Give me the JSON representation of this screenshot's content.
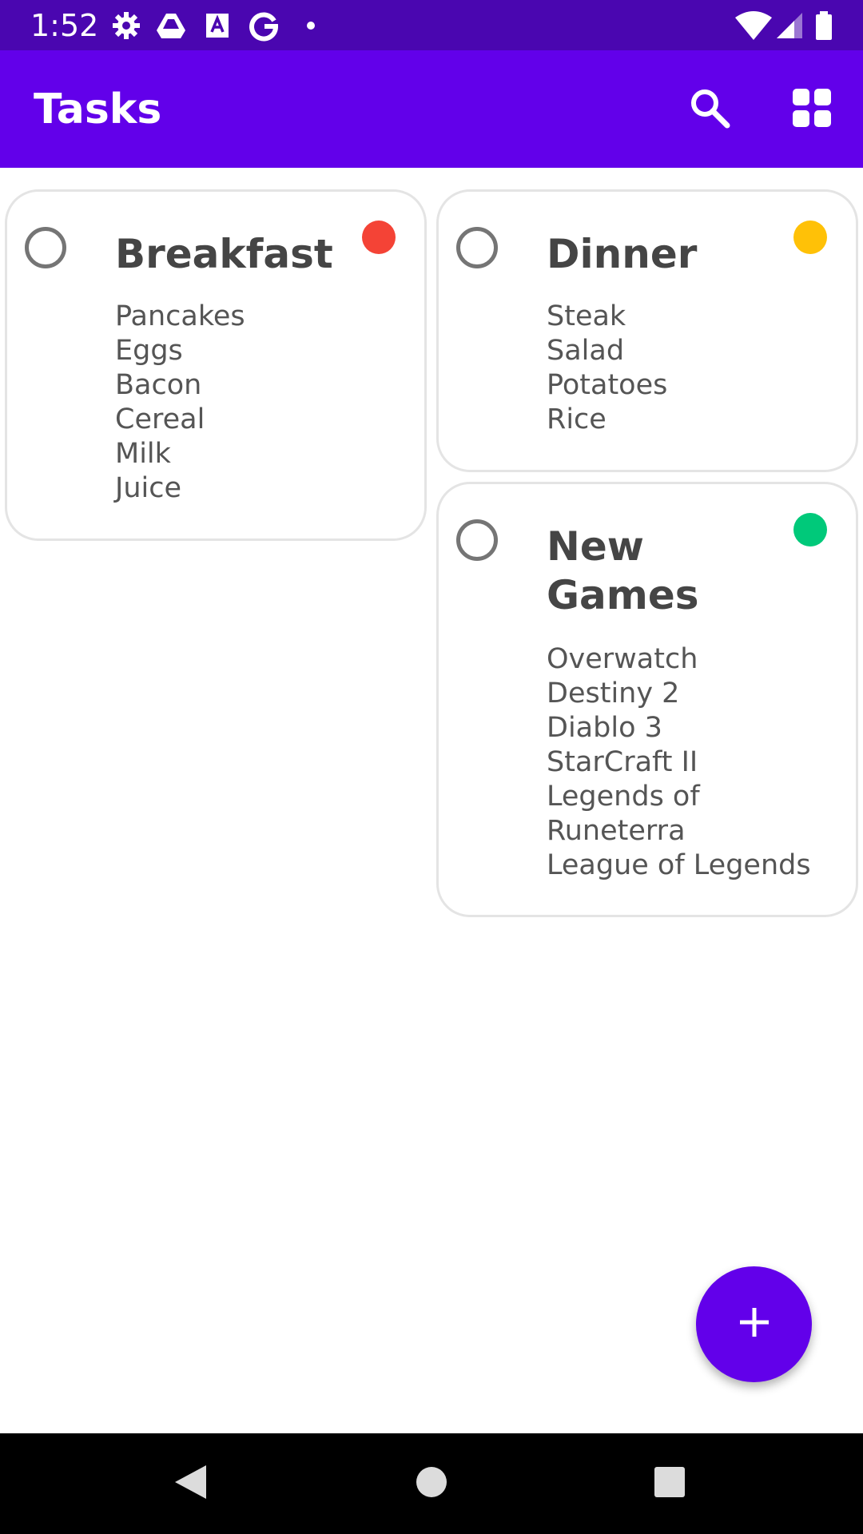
{
  "status_bar": {
    "time": "1:52",
    "left_icons": [
      "settings-icon",
      "drive-icon",
      "text-app-icon",
      "google-icon",
      "dot-icon"
    ],
    "right_icons": [
      "wifi-icon",
      "signal-icon",
      "battery-icon"
    ]
  },
  "app_bar": {
    "title": "Tasks",
    "actions": [
      "search-icon",
      "grid-view-icon"
    ]
  },
  "cards": [
    {
      "title": "Breakfast",
      "color": "#f44336",
      "items": [
        "Pancakes",
        "Eggs",
        "Bacon",
        "Cereal",
        "Milk",
        "Juice"
      ],
      "checked": false
    },
    {
      "title": "Dinner",
      "color": "#ffc107",
      "items": [
        "Steak",
        "Salad",
        "Potatoes",
        "Rice"
      ],
      "checked": false
    },
    {
      "title": "New Games",
      "title_lines": [
        "New",
        "Games"
      ],
      "color": "#00c97a",
      "items": [
        "Overwatch",
        "Destiny 2",
        "Diablo 3",
        "StarCraft II",
        "Legends of",
        "Runeterra",
        "League of Legends"
      ],
      "checked": false
    }
  ],
  "fab": {
    "icon": "plus-icon"
  },
  "colors": {
    "status_bar": "#4a06b0",
    "app_bar": "#6200ea",
    "accent": "#6200ea"
  },
  "nav_bar": {
    "buttons": [
      "back-icon",
      "home-icon",
      "recents-icon"
    ]
  }
}
